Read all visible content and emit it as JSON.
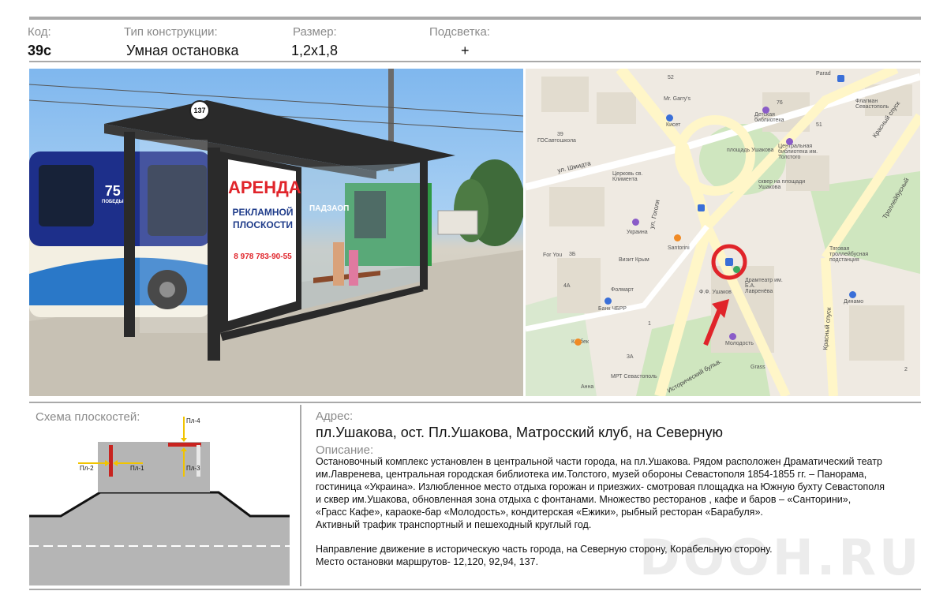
{
  "header": {
    "code_label": "Код:",
    "type_label": "Тип конструкции:",
    "size_label": "Размер:",
    "light_label": "Подсветка:",
    "code_value": "39с",
    "type_value": "Умная остановка",
    "size_value": "1,2х1,8",
    "light_value": "+"
  },
  "photo": {
    "stop_number": "137",
    "ad_title": "АРЕНДА",
    "ad_line1": "РЕКЛАМНОЙ",
    "ad_line2": "ПЛОСКОСТИ",
    "ad_phone": "8 978 783-90-55",
    "bus_badge": "75",
    "bus_badge_sub": "ПОБЕДЫ",
    "bus_name": "ПАДЗАОП",
    "colors": {
      "ad_red": "#e0242a",
      "ad_blue": "#1f3c8a",
      "shelter": "#2a2a2a"
    }
  },
  "map": {
    "labels": {
      "schmidta": "ул. Шмидта",
      "gogolya": "ул. Гоголя",
      "krasny1": "Красный спуск",
      "krasny2": "Красный спуск",
      "trolley": "Троллейбусный",
      "istorich": "Исторический бульв.",
      "ploshad": "площадь Ушакова",
      "skver": "сквер на площади Ушакова",
      "biblio": "Центральная библиотека им. Толстого",
      "detsk": "Детская библиотека",
      "flagman": "Флагман Севастополь",
      "tyag": "Тяговая троллейбусная подстанция",
      "dramteatr": "Драмтеатр им. Б.А. Лавренёва",
      "ushakov": "Ф.Ф. Ушаков",
      "molodost": "Молодость",
      "grass": "Grass",
      "dinamo": "Динамо",
      "mrgarry": "Mr. Garry's",
      "kiset": "Кисет",
      "gossvyaz": "ГОСавтошкола",
      "church": "Церковь св. Климента",
      "ukraina": "Украина",
      "santorini": "Santorini",
      "vizit": "Визит Крым",
      "foryou": "For You",
      "folmart": "Фолмарт",
      "bank": "Банк ЧБРР",
      "kazbek": "Казбек",
      "mrt": "МРТ Севастополь",
      "anna": "Анна",
      "parad": "Parad",
      "n52": "52",
      "n76": "76",
      "n51": "51",
      "n39": "39",
      "n3b": "3Б",
      "n4a": "4А",
      "n1": "1",
      "n3a": "3А",
      "n2": "2"
    },
    "colors": {
      "marker": "#e0242a",
      "poi_blue": "#3a6fd8",
      "poi_orange": "#f08a24",
      "poi_purple": "#8a5cc8",
      "poi_green": "#3aa860",
      "park": "#cfe6bf",
      "road": "#fff6c8"
    }
  },
  "schema": {
    "title": "Схема плоскостей:",
    "pl1": "Пл-1",
    "pl2": "Пл-2",
    "pl3": "Пл-3",
    "pl4": "Пл-4"
  },
  "address": {
    "label": "Адрес:",
    "value": "пл.Ушакова, ост. Пл.Ушакова, Матросский клуб, на Северную"
  },
  "description": {
    "label": "Описание:",
    "l1": "Остановочный комплекс  установлен в центральной части  города, на пл.Ушакова. Рядом расположен Драматический театр",
    "l2": "им.Лавренева,  центральная городская библиотека им.Толстого, музей обороны Севастополя 1854-1855 гг. – Панорама,",
    "l3": "гостиница «Украина». Излюбленное место отдыха горожан и приезжих- смотровая площадка на Южную бухту Севастополя",
    "l4": "и сквер им.Ушакова, обновленная зона отдыха с фонтанами. Множество ресторанов , кафе и баров – «Санторини»,",
    "l5": "«Грасс Кафе», караоке-бар «Молодость», кондитерская «Ежики»,  рыбный ресторан «Барабуля».",
    "l6": "Активный трафик транспортный и пешеходный круглый год.",
    "l7": "Направление движение в историческую часть города, на Северную сторону, Корабельную сторону.",
    "l8": "Место остановки маршрутов- 12,120, 92,94, 137."
  },
  "watermark": "DOOH.RU"
}
